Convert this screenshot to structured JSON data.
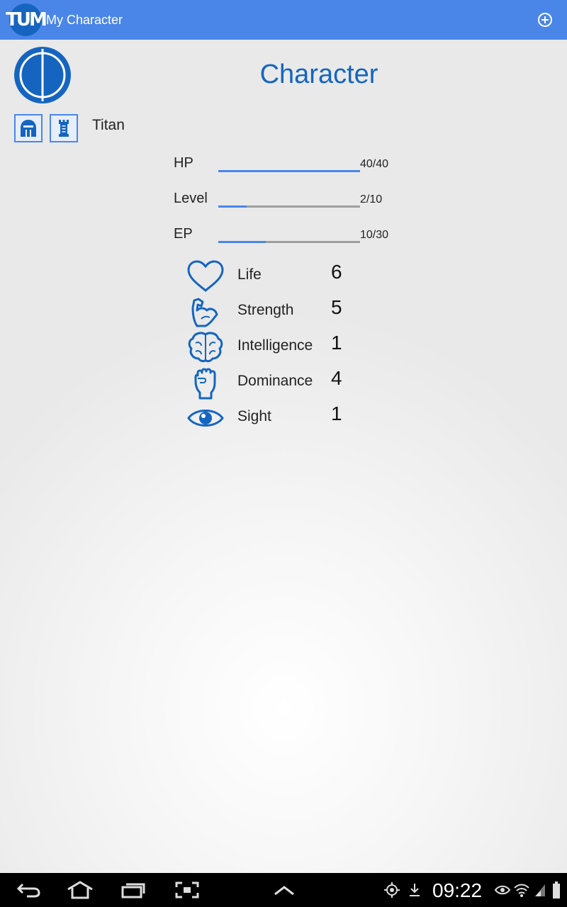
{
  "app": {
    "logo_text": "TUM",
    "title": "My Character",
    "add_icon": "add-circle-icon"
  },
  "page": {
    "title": "Character"
  },
  "character": {
    "class_icons": [
      "helmet-icon",
      "tower-icon"
    ],
    "class_name": "Titan"
  },
  "bars": [
    {
      "label": "HP",
      "value": "40/40",
      "fraction": 1.0
    },
    {
      "label": "Level",
      "value": "2/10",
      "fraction": 0.2
    },
    {
      "label": "EP",
      "value": "10/30",
      "fraction": 0.333
    }
  ],
  "attributes": [
    {
      "icon": "heart-icon",
      "label": "Life",
      "value": "6"
    },
    {
      "icon": "flexed-arm-icon",
      "label": "Strength",
      "value": "5"
    },
    {
      "icon": "brain-icon",
      "label": "Intelligence",
      "value": "1"
    },
    {
      "icon": "fist-icon",
      "label": "Dominance",
      "value": "4"
    },
    {
      "icon": "eye-icon",
      "label": "Sight",
      "value": "1"
    }
  ],
  "status_bar": {
    "time": "09:22"
  },
  "colors": {
    "accent": "#4a86e8",
    "title_blue": "#1565c0"
  }
}
